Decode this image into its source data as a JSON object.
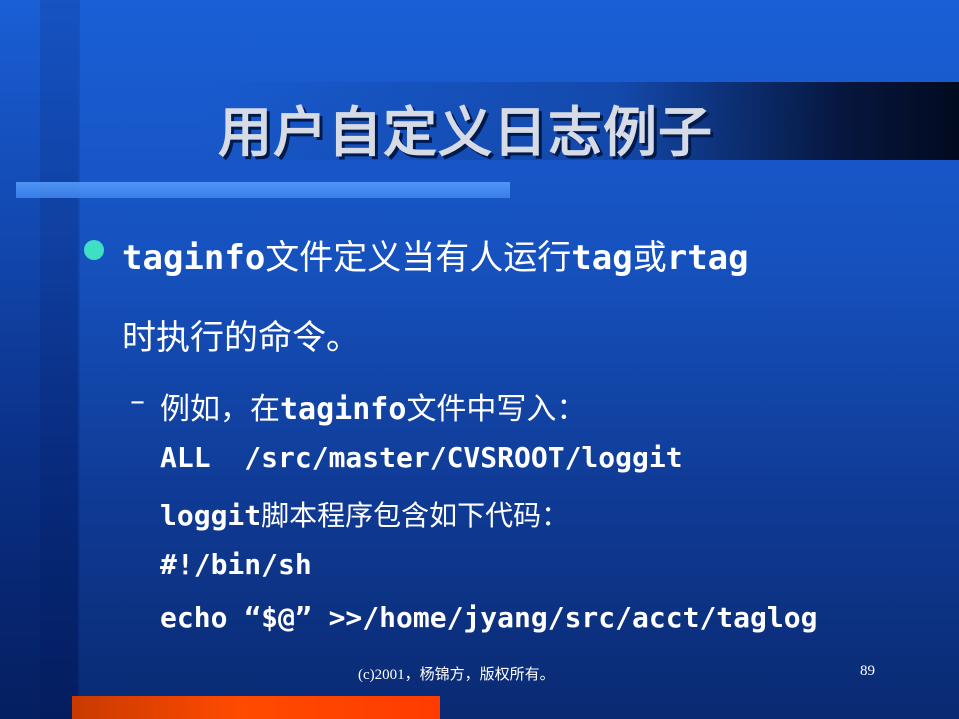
{
  "slide": {
    "title": "用户自定义日志例子",
    "bullet": {
      "line1_mono": "taginfo",
      "line1_cjk": "文件定义当有人运行",
      "line1_mono2": "tag",
      "line1_cjk2": "或",
      "line1_mono3": "rtag",
      "line2": "时执行的命令。"
    },
    "sub_dash": "–",
    "sub": {
      "prefix": "例如，在",
      "mono": "taginfo",
      "suffix": "文件中写入："
    },
    "code_lines": {
      "c1": "ALL  /src/master/CVSROOT/loggit",
      "c2_mono": "loggit",
      "c2_cjk": "脚本程序包含如下代码：",
      "c3": "#!/bin/sh",
      "c4": "echo “$@” >>/home/jyang/src/acct/taglog"
    },
    "footer": "(c)2001，杨锦方，版权所有。",
    "page_number": "89"
  },
  "colors": {
    "background": "#1652bf",
    "bullet": "#3de0c4",
    "accent_bar": "#ff4a00",
    "accent_line": "#5aa0ff"
  }
}
